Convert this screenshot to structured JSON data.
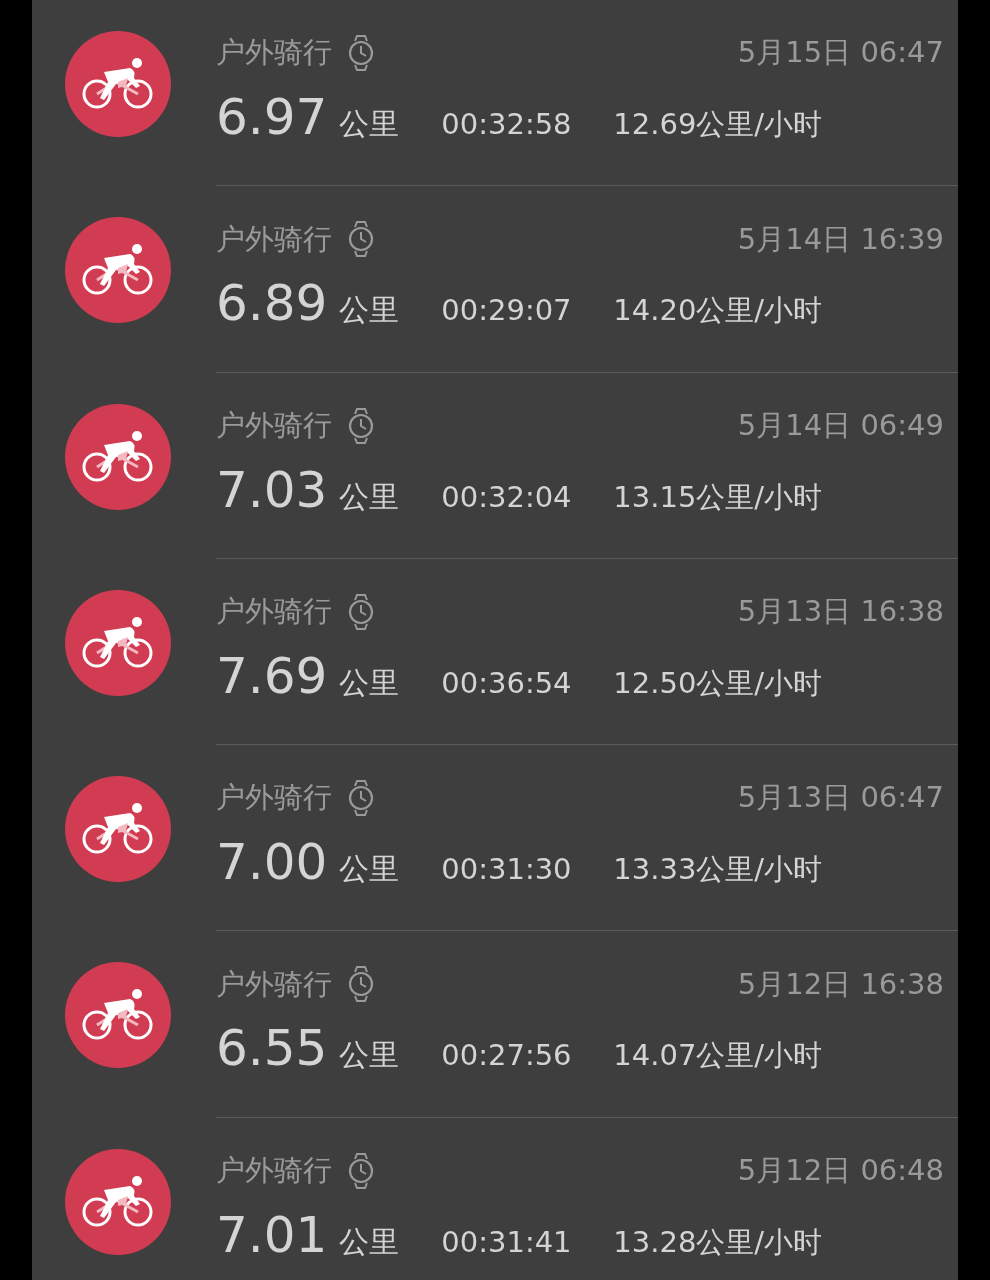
{
  "workouts": [
    {
      "type": "户外骑行",
      "date": "5月15日 06:47",
      "distance": "6.97",
      "unit": "公里",
      "duration": "00:32:58",
      "speed": "12.69公里/小时"
    },
    {
      "type": "户外骑行",
      "date": "5月14日 16:39",
      "distance": "6.89",
      "unit": "公里",
      "duration": "00:29:07",
      "speed": "14.20公里/小时"
    },
    {
      "type": "户外骑行",
      "date": "5月14日 06:49",
      "distance": "7.03",
      "unit": "公里",
      "duration": "00:32:04",
      "speed": "13.15公里/小时"
    },
    {
      "type": "户外骑行",
      "date": "5月13日 16:38",
      "distance": "7.69",
      "unit": "公里",
      "duration": "00:36:54",
      "speed": "12.50公里/小时"
    },
    {
      "type": "户外骑行",
      "date": "5月13日 06:47",
      "distance": "7.00",
      "unit": "公里",
      "duration": "00:31:30",
      "speed": "13.33公里/小时"
    },
    {
      "type": "户外骑行",
      "date": "5月12日 16:38",
      "distance": "6.55",
      "unit": "公里",
      "duration": "00:27:56",
      "speed": "14.07公里/小时"
    },
    {
      "type": "户外骑行",
      "date": "5月12日 06:48",
      "distance": "7.01",
      "unit": "公里",
      "duration": "00:31:41",
      "speed": "13.28公里/小时"
    }
  ]
}
